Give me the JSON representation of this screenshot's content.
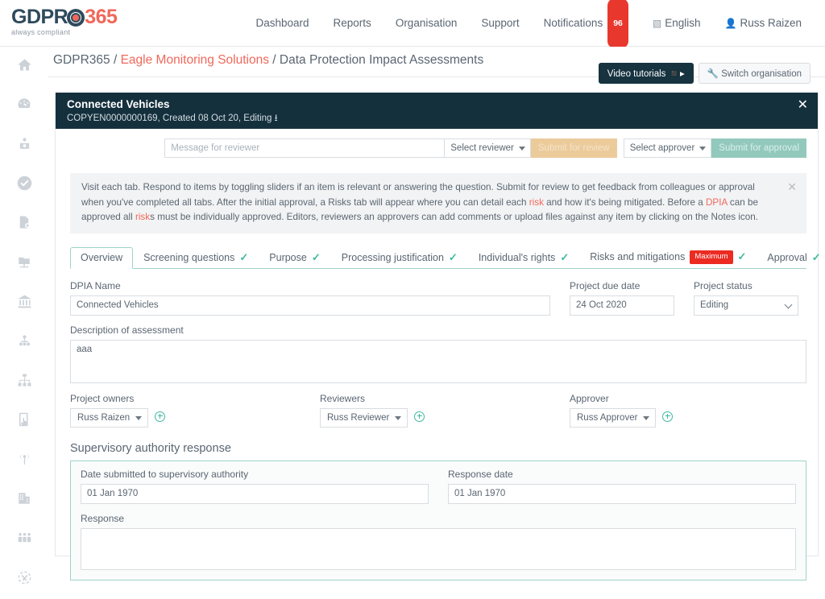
{
  "brand": {
    "logo_main": "GDPR",
    "logo_suffix": "365",
    "logo_tagline": "always compliant",
    "accent": "#f0685a",
    "dark": "#2e4a5c",
    "teal": "#3fb9a0"
  },
  "topnav": {
    "items": [
      {
        "label": "Dashboard"
      },
      {
        "label": "Reports"
      },
      {
        "label": "Organisation"
      },
      {
        "label": "Support"
      }
    ],
    "notifications": {
      "label": "Notifications",
      "count": "96"
    },
    "language": {
      "label": "English",
      "icon": "translate-icon"
    },
    "user": {
      "label": "Russ Raizen",
      "icon": "user-icon"
    }
  },
  "sidebar": {
    "items": [
      {
        "name": "home",
        "label": "Home"
      },
      {
        "name": "dashboard",
        "label": "Dashboard"
      },
      {
        "name": "data-subject",
        "label": "Data subject"
      },
      {
        "name": "compliance",
        "label": "Compliance"
      },
      {
        "name": "documents",
        "label": "Documents"
      },
      {
        "name": "records",
        "label": "Records"
      },
      {
        "name": "authority",
        "label": "Authority"
      },
      {
        "name": "people",
        "label": "People"
      },
      {
        "name": "org-chart",
        "label": "Org chart"
      },
      {
        "name": "consent",
        "label": "Consent"
      },
      {
        "name": "processing",
        "label": "Processing"
      },
      {
        "name": "company",
        "label": "Company"
      },
      {
        "name": "staff",
        "label": "Staff"
      },
      {
        "name": "transfers",
        "label": "Transfers"
      }
    ]
  },
  "breadcrumb": {
    "root": "GDPR365",
    "sep": "/",
    "org": "Eagle Monitoring Solutions",
    "page": "Data Protection Impact Assessments"
  },
  "page_actions": {
    "video_tutorials": "Video tutorials",
    "video_icon": "video-camera-icon",
    "switch_organisation": "Switch organisation",
    "wrench_icon": "wrench-icon"
  },
  "panel": {
    "title": "Connected Vehicles",
    "subtitle": "COPYEN0000000169, Created 08 Oct 20, Editing",
    "download_icon": "download-icon",
    "close_icon": "close-icon"
  },
  "review_row": {
    "message_placeholder": "Message for reviewer",
    "message_value": "",
    "select_reviewer": "Select reviewer",
    "submit_for_review": "Submit for review",
    "select_approver": "Select approver",
    "submit_for_approval": "Submit for approval"
  },
  "info": {
    "p1": "Visit each tab. Respond to items by toggling sliders if an item is relevant or answering the question. Submit for review to get feedback from colleagues or approval when you've completed all tabs. After the initial approval, a Risks tab will appear where you can detail each ",
    "risk1": "risk",
    "p2": " and how it's being mitigated. Before a ",
    "dpia": "DPIA",
    "p3": " can be approved all ",
    "risk2": "risk",
    "p4": "s must be individually approved. Editors, reviewers an approvers can add comments or upload files against any item by clicking on the Notes icon.",
    "close_icon": "close-icon"
  },
  "tabs": [
    {
      "label": "Overview",
      "active": true,
      "check": false,
      "badge": ""
    },
    {
      "label": "Screening questions",
      "active": false,
      "check": true,
      "badge": ""
    },
    {
      "label": "Purpose",
      "active": false,
      "check": true,
      "badge": ""
    },
    {
      "label": "Processing justification",
      "active": false,
      "check": true,
      "badge": ""
    },
    {
      "label": "Individual's rights",
      "active": false,
      "check": true,
      "badge": ""
    },
    {
      "label": "Risks and mitigations",
      "active": false,
      "check": true,
      "badge": "Maximum"
    },
    {
      "label": "Approval",
      "active": false,
      "check": true,
      "badge": ""
    }
  ],
  "form": {
    "dpia_name_label": "DPIA Name",
    "dpia_name_value": "Connected Vehicles",
    "project_due_date_label": "Project due date",
    "project_due_date_value": "24 Oct 2020",
    "project_status_label": "Project status",
    "project_status_value": "Editing",
    "description_label": "Description of assessment",
    "description_value": "aaa",
    "project_owners_label": "Project owners",
    "project_owners_value": "Russ Raizen",
    "reviewers_label": "Reviewers",
    "reviewers_value": "Russ Reviewer",
    "approver_label": "Approver",
    "approver_value": "Russ Approver"
  },
  "supervisory": {
    "title": "Supervisory authority response",
    "date_submitted_label": "Date submitted to supervisory authority",
    "date_submitted_value": "01 Jan 1970",
    "response_date_label": "Response date",
    "response_date_value": "01 Jan 1970",
    "response_label": "Response",
    "response_value": ""
  }
}
